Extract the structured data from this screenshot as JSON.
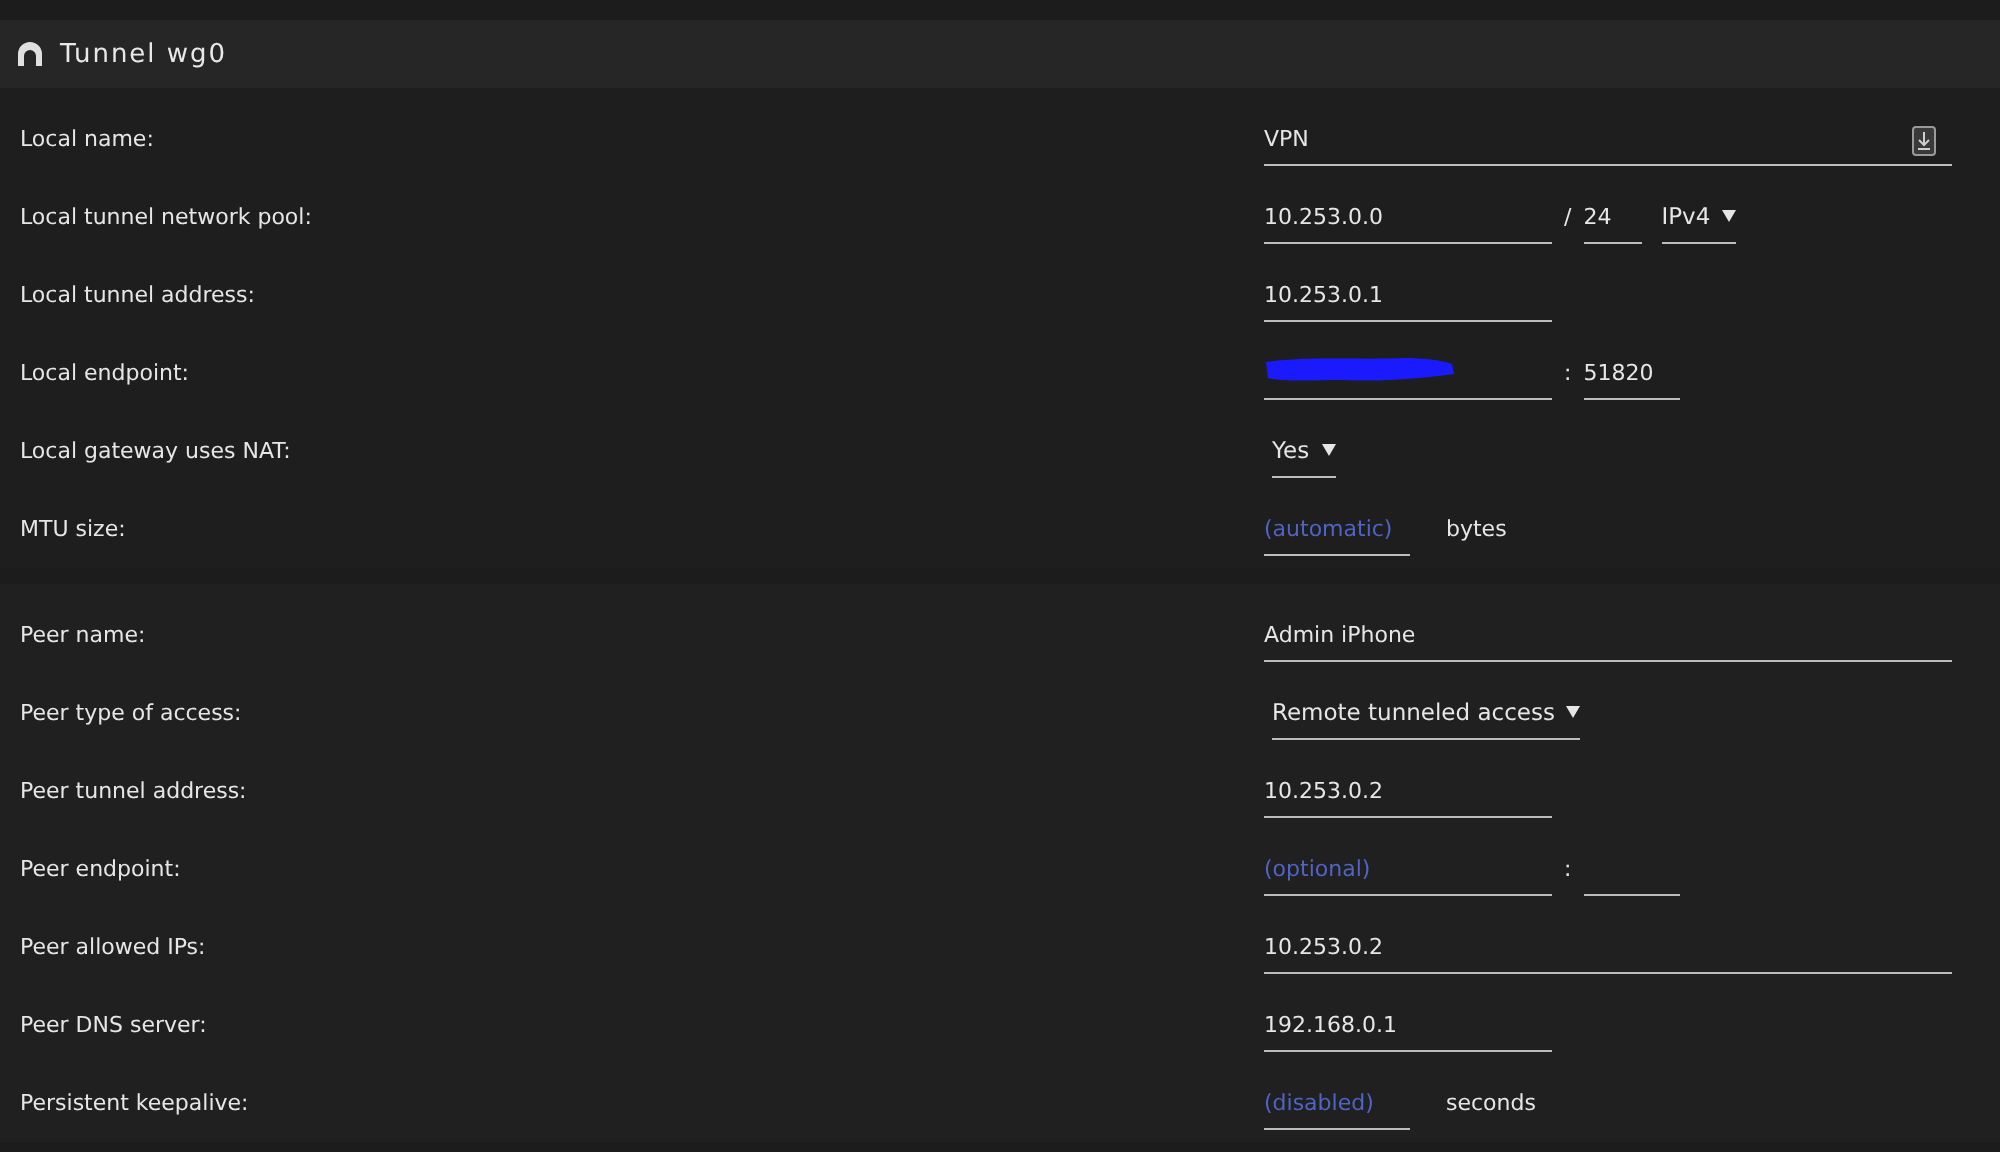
{
  "header": {
    "title": "Tunnel wg0"
  },
  "sections": [
    {
      "rows": [
        {
          "label": "Local name:",
          "fields": [
            {
              "kind": "wide-input",
              "value": "VPN",
              "icon": true
            }
          ]
        },
        {
          "label": "Local tunnel network pool:",
          "fields": [
            {
              "kind": "input",
              "value": "10.253.0.0"
            },
            {
              "kind": "text",
              "text": "/"
            },
            {
              "kind": "short-input",
              "value": "24"
            },
            {
              "kind": "select",
              "value": "IPv4"
            }
          ]
        },
        {
          "label": "Local tunnel address:",
          "fields": [
            {
              "kind": "input",
              "value": "10.253.0.1"
            }
          ]
        },
        {
          "label": "Local endpoint:",
          "fields": [
            {
              "kind": "input",
              "redacted": true
            },
            {
              "kind": "text",
              "text": ":"
            },
            {
              "kind": "port-input",
              "value": "51820"
            }
          ]
        },
        {
          "label": "Local gateway uses NAT:",
          "fields": [
            {
              "kind": "select",
              "value": "Yes"
            }
          ]
        },
        {
          "label": "MTU size:",
          "fields": [
            {
              "kind": "small-input",
              "placeholder": "(automatic)"
            },
            {
              "kind": "unit",
              "text": "bytes"
            }
          ]
        }
      ]
    },
    {
      "rows": [
        {
          "label": "Peer name:",
          "fields": [
            {
              "kind": "wide-input",
              "value": "Admin iPhone"
            }
          ]
        },
        {
          "label": "Peer type of access:",
          "fields": [
            {
              "kind": "select",
              "value": "Remote tunneled access"
            }
          ]
        },
        {
          "label": "Peer tunnel address:",
          "fields": [
            {
              "kind": "input",
              "value": "10.253.0.2"
            }
          ]
        },
        {
          "label": "Peer endpoint:",
          "fields": [
            {
              "kind": "input",
              "placeholder": "(optional)"
            },
            {
              "kind": "text",
              "text": ":"
            },
            {
              "kind": "port-input"
            }
          ]
        },
        {
          "label": "Peer allowed IPs:",
          "fields": [
            {
              "kind": "wide-input",
              "value": "10.253.0.2"
            }
          ]
        },
        {
          "label": "Peer DNS server:",
          "fields": [
            {
              "kind": "input",
              "value": "192.168.0.1"
            }
          ]
        },
        {
          "label": "Persistent keepalive:",
          "fields": [
            {
              "kind": "small-input",
              "placeholder": "(disabled)"
            },
            {
              "kind": "unit",
              "text": "seconds"
            }
          ]
        }
      ]
    }
  ]
}
